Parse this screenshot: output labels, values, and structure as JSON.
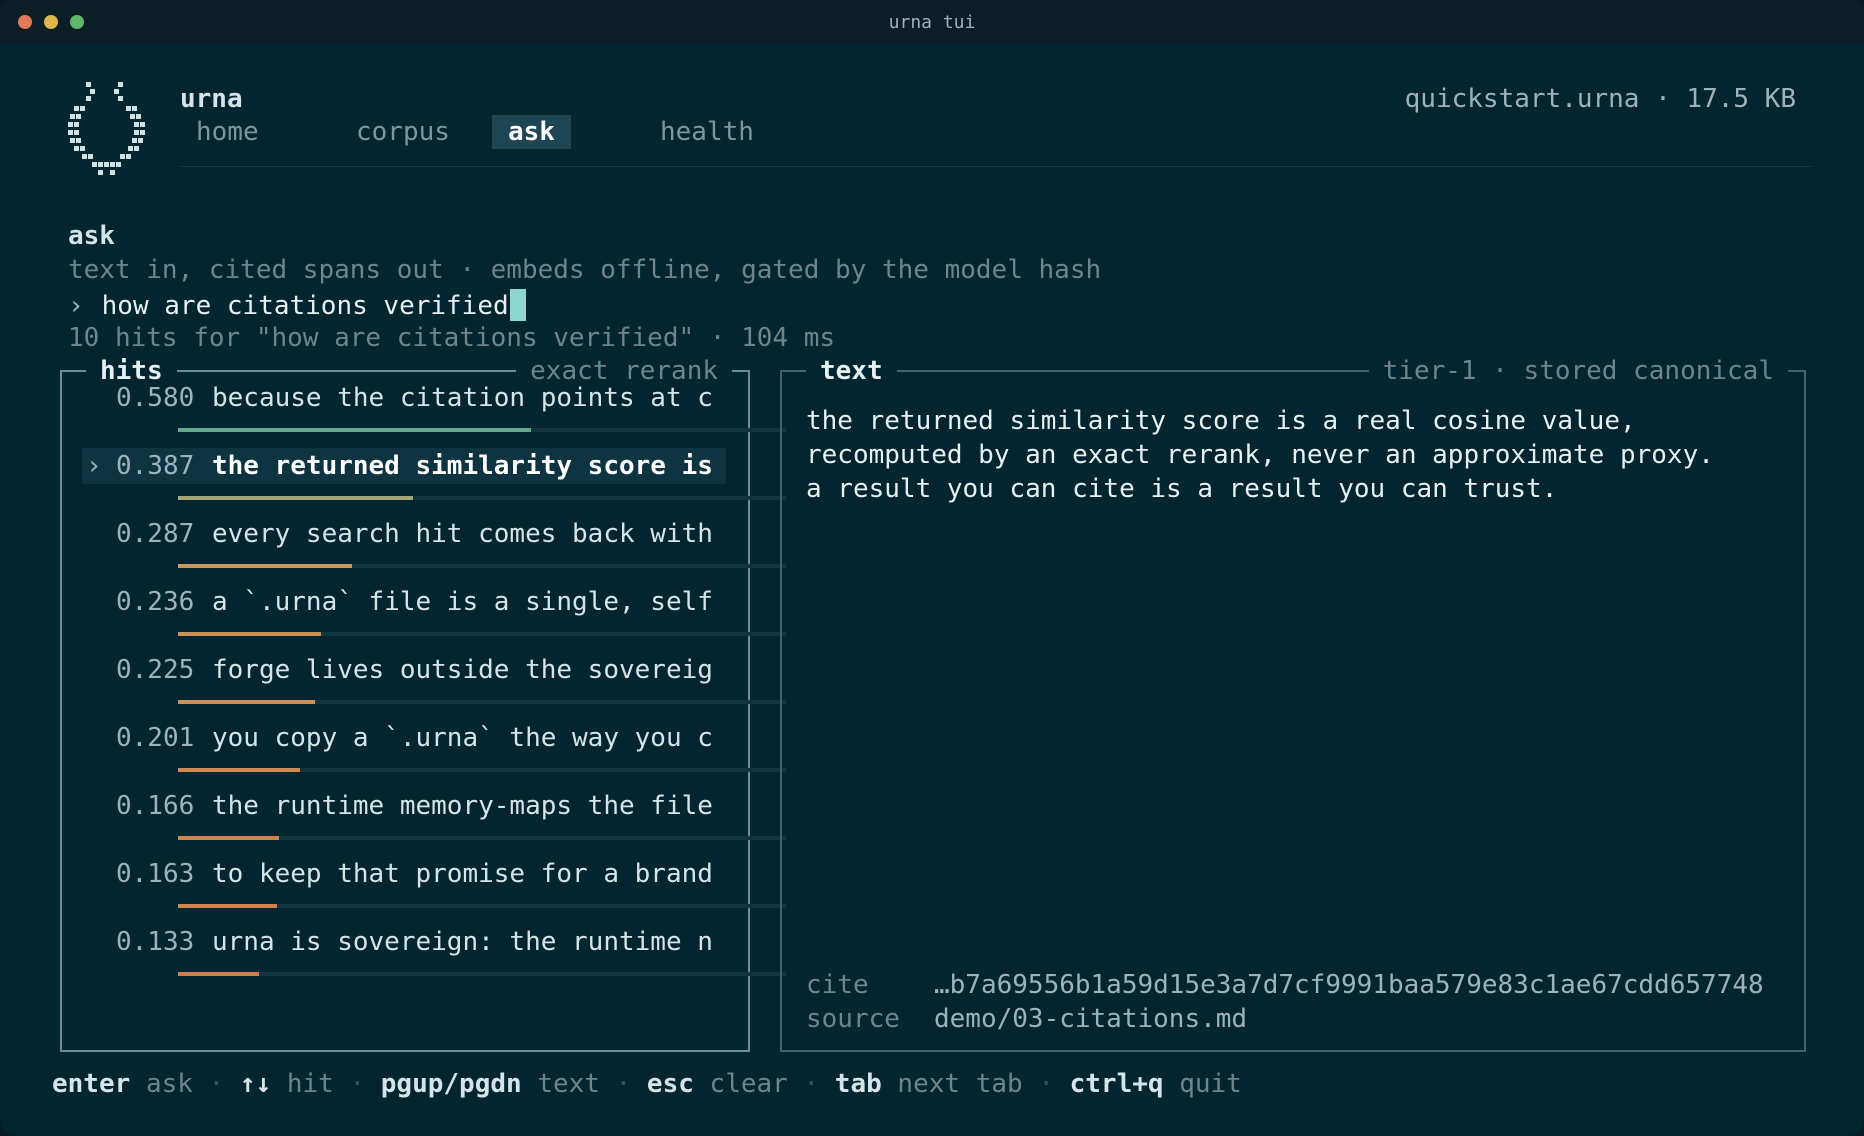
{
  "window": {
    "title": "urna tui"
  },
  "header": {
    "app_name": "urna",
    "file_info": "quickstart.urna · 17.5 KB",
    "tabs": [
      {
        "label": "home",
        "active": false
      },
      {
        "label": "corpus",
        "active": false
      },
      {
        "label": "ask",
        "active": true
      },
      {
        "label": "health",
        "active": false
      }
    ]
  },
  "ask": {
    "heading": "ask",
    "subtitle": "text in, cited spans out · embeds offline, gated by the model hash",
    "prompt_caret": "›",
    "query": "how are citations verified",
    "status": "10 hits for \"how are citations verified\" · 104 ms"
  },
  "hits_panel": {
    "title": "hits",
    "subtitle": "exact rerank",
    "selected_marker": "›",
    "items": [
      {
        "score": "0.580",
        "snippet": "because the citation points at c",
        "fill": 0.58,
        "color": "#64a88a",
        "selected": false
      },
      {
        "score": "0.387",
        "snippet": "the returned similarity score is",
        "fill": 0.387,
        "color": "#a3a676",
        "selected": true
      },
      {
        "score": "0.287",
        "snippet": "every search hit comes back with",
        "fill": 0.287,
        "color": "#c99c5c",
        "selected": false
      },
      {
        "score": "0.236",
        "snippet": "a `.urna` file is a single, self",
        "fill": 0.236,
        "color": "#cd9356",
        "selected": false
      },
      {
        "score": "0.225",
        "snippet": "forge lives outside the sovereig",
        "fill": 0.225,
        "color": "#cd9356",
        "selected": false
      },
      {
        "score": "0.201",
        "snippet": "you copy a `.urna` the way you c",
        "fill": 0.201,
        "color": "#cf8c52",
        "selected": false
      },
      {
        "score": "0.166",
        "snippet": "the runtime memory-maps the file",
        "fill": 0.166,
        "color": "#d0854f",
        "selected": false
      },
      {
        "score": "0.163",
        "snippet": "to keep that promise for a brand",
        "fill": 0.163,
        "color": "#d0854f",
        "selected": false
      },
      {
        "score": "0.133",
        "snippet": "urna is sovereign: the runtime n",
        "fill": 0.133,
        "color": "#d07f4d",
        "selected": false
      }
    ]
  },
  "text_panel": {
    "title": "text",
    "subtitle": "tier-1 · stored canonical",
    "body": "the returned similarity score is a real cosine value,\nrecomputed by an exact rerank, never an approximate proxy.\na result you can cite is a result you can trust.",
    "cite_label": "cite",
    "cite_value": "…b7a69556b1a59d15e3a7d7cf9991baa579e83c1ae67cdd657748",
    "source_label": "source",
    "source_value": "demo/03-citations.md"
  },
  "footer": {
    "separator": "·",
    "shortcuts": [
      {
        "key": "enter",
        "desc": "ask"
      },
      {
        "key": "↑↓",
        "desc": "hit"
      },
      {
        "key": "pgup/pgdn",
        "desc": "text"
      },
      {
        "key": "esc",
        "desc": "clear"
      },
      {
        "key": "tab",
        "desc": "next tab"
      },
      {
        "key": "ctrl+q",
        "desc": "quit"
      }
    ]
  },
  "colors": {
    "background": "#03252f",
    "panel_border": "#6a8d97",
    "accent_cursor": "#8fd6d0"
  }
}
